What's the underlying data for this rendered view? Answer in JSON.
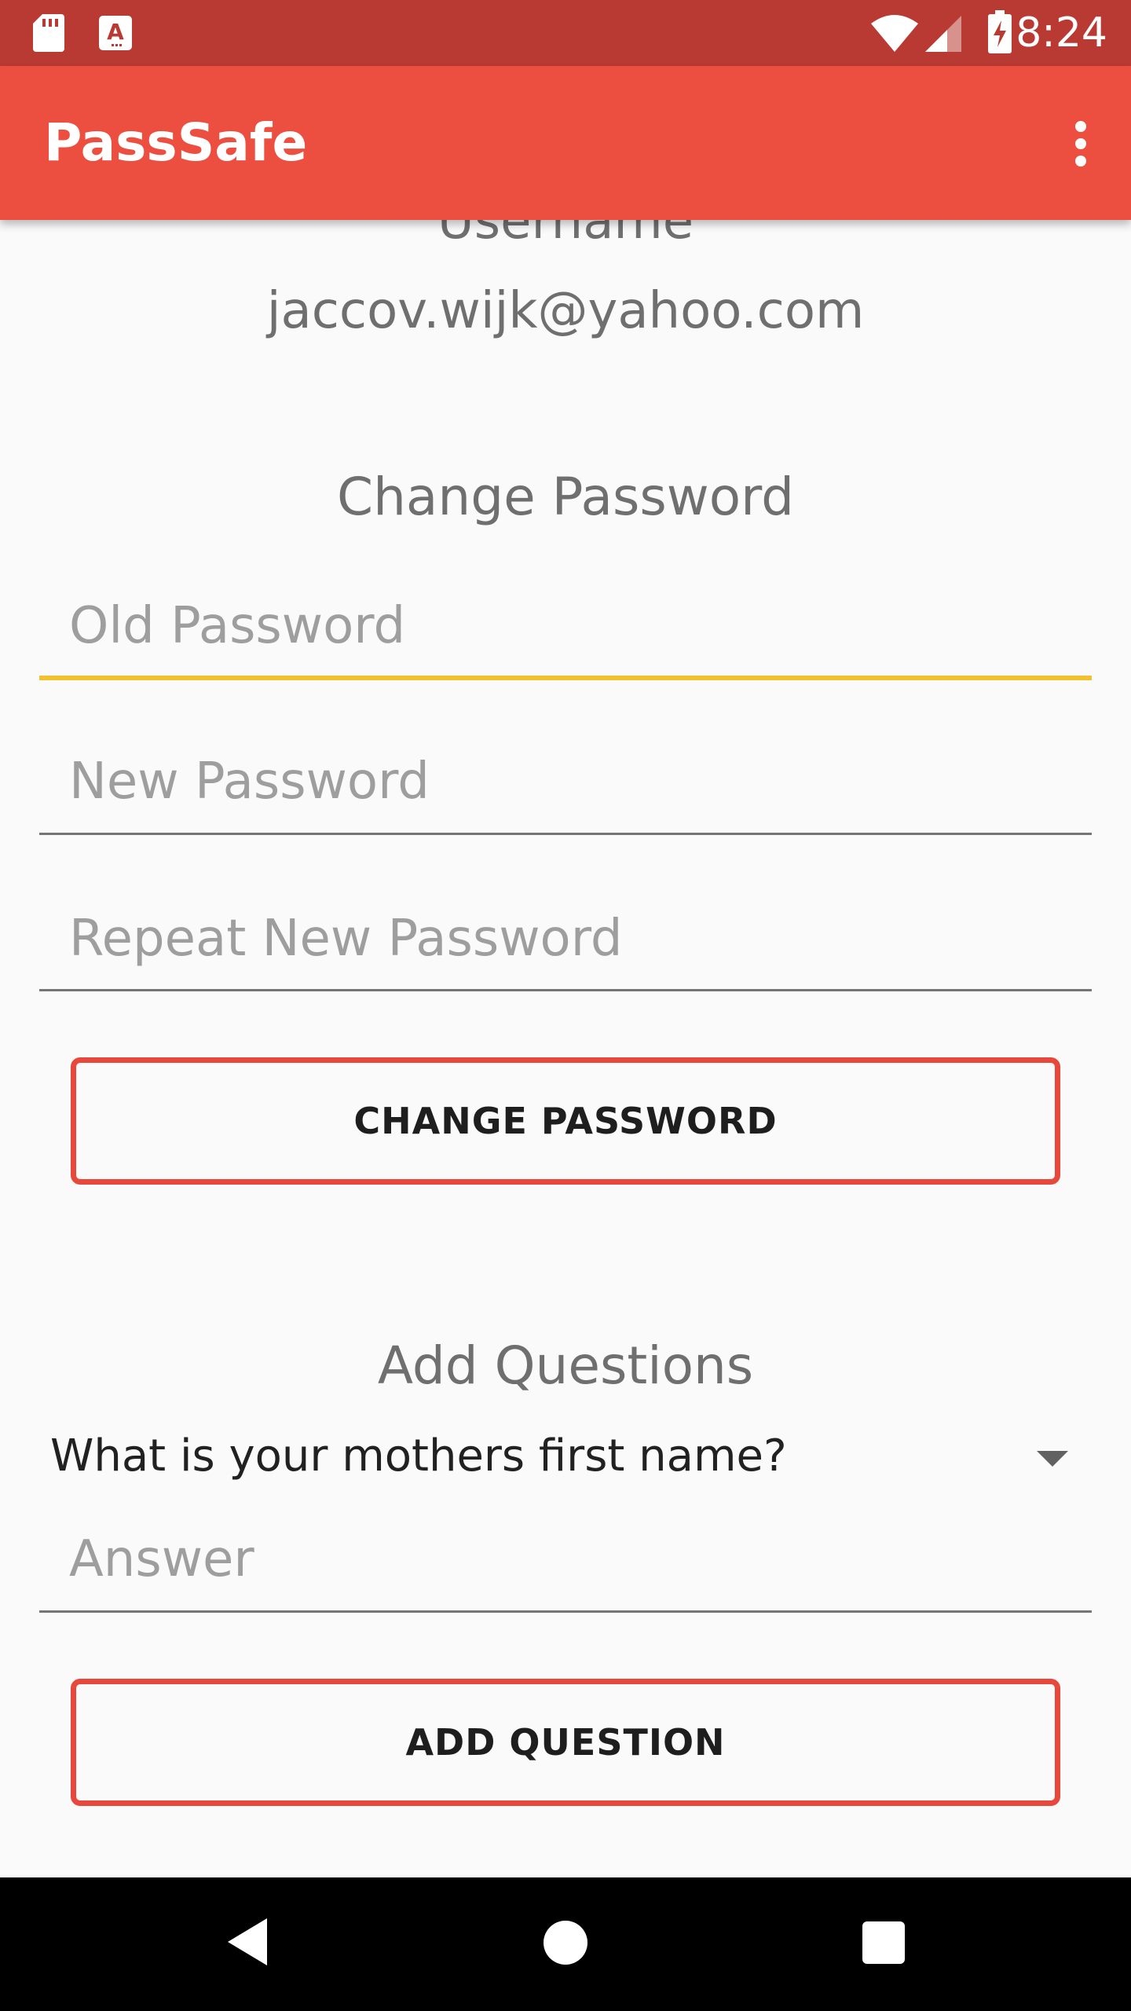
{
  "status_bar": {
    "time": "8:24",
    "icons": [
      "sd-card-icon",
      "accessibility-a-icon",
      "wifi-icon",
      "cell-signal-icon",
      "battery-charging-icon"
    ]
  },
  "app_bar": {
    "title": "PassSafe",
    "menu_icon": "overflow-menu-icon"
  },
  "account": {
    "username_label": "Username",
    "username_value": "jaccov.wijk@yahoo.com"
  },
  "change_password": {
    "heading": "Change Password",
    "old_password_placeholder": "Old Password",
    "new_password_placeholder": "New Password",
    "repeat_password_placeholder": "Repeat New Password",
    "button_label": "CHANGE PASSWORD"
  },
  "add_questions": {
    "heading": "Add Questions",
    "selected_question": "What is your mothers first name?",
    "answer_placeholder": "Answer",
    "button_label": "ADD QUESTION"
  },
  "nav_bar": {
    "icons": [
      "back-icon",
      "home-icon",
      "recents-icon"
    ]
  },
  "colors": {
    "status_bar": "#b93a32",
    "app_bar": "#ec4f40",
    "button_border": "#e8473b",
    "focus_underline": "#f2c12e"
  }
}
